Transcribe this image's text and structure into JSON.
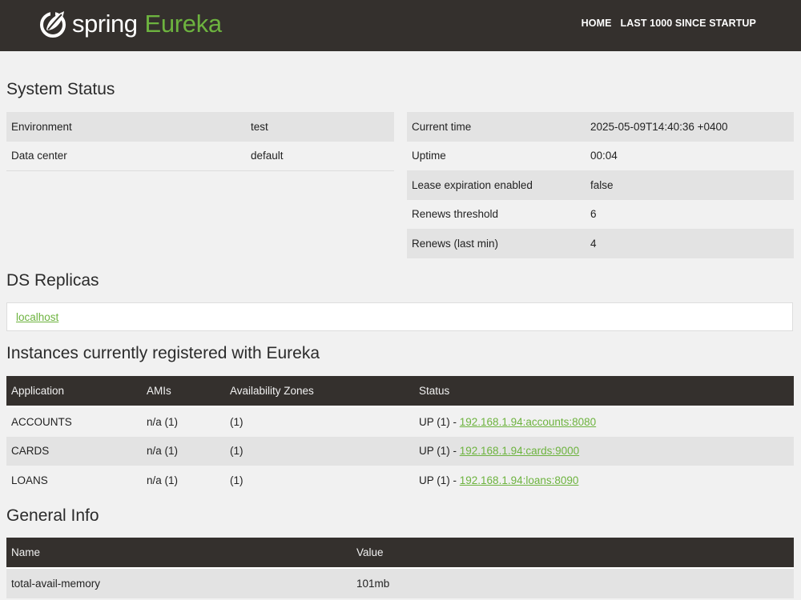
{
  "header": {
    "brand_spring": "spring",
    "brand_eureka": "Eureka",
    "nav": [
      "HOME",
      "LAST 1000 SINCE STARTUP"
    ]
  },
  "system_status": {
    "title": "System Status",
    "left": [
      {
        "label": "Environment",
        "value": "test"
      },
      {
        "label": "Data center",
        "value": "default"
      }
    ],
    "right": [
      {
        "label": "Current time",
        "value": "2025-05-09T14:40:36 +0400"
      },
      {
        "label": "Uptime",
        "value": "00:04"
      },
      {
        "label": "Lease expiration enabled",
        "value": "false"
      },
      {
        "label": "Renews threshold",
        "value": "6"
      },
      {
        "label": "Renews (last min)",
        "value": "4"
      }
    ]
  },
  "ds_replicas": {
    "title": "DS Replicas",
    "link": "localhost"
  },
  "instances": {
    "title": "Instances currently registered with Eureka",
    "columns": [
      "Application",
      "AMIs",
      "Availability Zones",
      "Status"
    ],
    "rows": [
      {
        "application": "ACCOUNTS",
        "amis": "n/a (1)",
        "zones": "(1)",
        "status": "UP (1) - ",
        "link": "192.168.1.94:accounts:8080"
      },
      {
        "application": "CARDS",
        "amis": "n/a (1)",
        "zones": "(1)",
        "status": "UP (1) - ",
        "link": "192.168.1.94:cards:9000"
      },
      {
        "application": "LOANS",
        "amis": "n/a (1)",
        "zones": "(1)",
        "status": "UP (1) - ",
        "link": "192.168.1.94:loans:8090"
      }
    ]
  },
  "general_info": {
    "title": "General Info",
    "columns": [
      "Name",
      "Value"
    ],
    "rows": [
      {
        "name": "total-avail-memory",
        "value": "101mb"
      }
    ]
  },
  "colors": {
    "header_bg": "#34302d",
    "accent_green": "#6db33f",
    "page_bg": "#f1f1f1",
    "row_stripe": "#e3e3e3"
  },
  "icons": {
    "logo": "spring-leaf-icon"
  }
}
